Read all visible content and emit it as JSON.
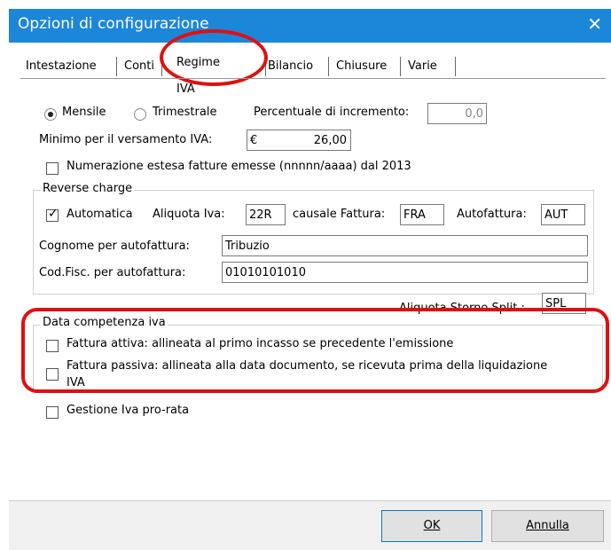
{
  "window": {
    "title": "Opzioni di configurazione"
  },
  "tabs": [
    "Intestazione",
    "Conti",
    "Regime IVA",
    "Bilancio",
    "Chiusure",
    "Varie"
  ],
  "radio": {
    "monthly": "Mensile",
    "quarterly": "Trimestrale"
  },
  "increment": {
    "label": "Percentuale di incremento:",
    "value": "0,0"
  },
  "minimum": {
    "label": "Minimo per il versamento IVA:",
    "currency": "€",
    "value": "26,00"
  },
  "extended_numbering": "Numerazione estesa fatture emesse (nnnnn/aaaa) dal 2013",
  "reverse_charge": {
    "title": "Reverse charge",
    "automatic": "Automatica",
    "vat_rate_label": "Aliquota Iva:",
    "vat_rate": "22R",
    "invoice_cause_label": "causale Fattura:",
    "invoice_cause": "FRA",
    "self_invoice_label": "Autofattura:",
    "self_invoice": "AUT",
    "surname_label": "Cognome per autofattura:",
    "surname": "Tribuzio",
    "taxcode_label": "Cod.Fisc. per autofattura:",
    "taxcode": "01010101010"
  },
  "split": {
    "label": "Aliquota Storno Split :",
    "value": "SPL"
  },
  "vat_date": {
    "title": "Data competenza iva",
    "active": "Fattura attiva: allineata al primo incasso se precedente l'emissione",
    "passive_1": "Fattura passiva: allineata alla data documento, se ricevuta prima della liquidazione",
    "passive_2": "IVA"
  },
  "prorata": "Gestione Iva pro-rata",
  "buttons": {
    "ok": "OK",
    "cancel": "Annulla"
  }
}
